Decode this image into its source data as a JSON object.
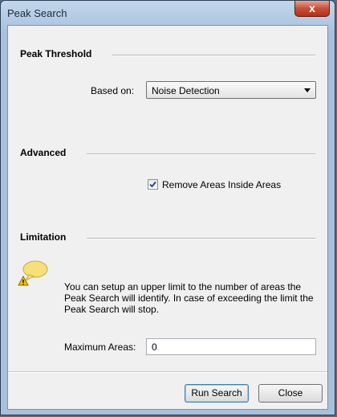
{
  "window": {
    "title": "Peak Search",
    "close_glyph": "x"
  },
  "peak_threshold": {
    "heading": "Peak Threshold",
    "based_on_label": "Based on:",
    "based_on_value": "Noise Detection"
  },
  "advanced": {
    "heading": "Advanced",
    "remove_areas_label": "Remove Areas Inside Areas",
    "remove_areas_checked": true
  },
  "limitation": {
    "heading": "Limitation",
    "icon": "warning-note-icon",
    "info_text": "You can setup an upper limit to the number of areas the Peak Search will identify. In case of exceeding the limit the Peak Search will stop.",
    "max_areas_label": "Maximum Areas:",
    "max_areas_value": "0"
  },
  "buttons": {
    "run": "Run Search",
    "close": "Close"
  },
  "colors": {
    "accent": "#3c7fb1",
    "close_red": "#c94f37"
  }
}
